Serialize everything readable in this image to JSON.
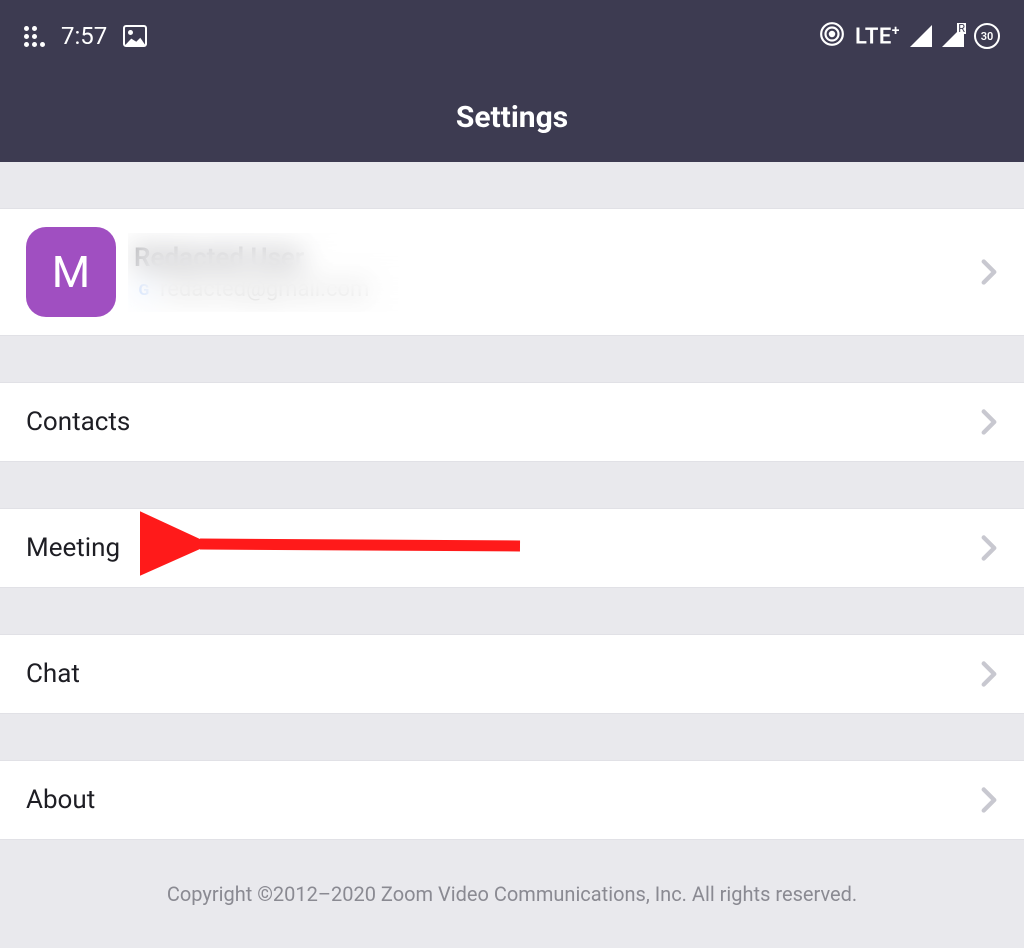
{
  "status": {
    "time": "7:57",
    "lte": "LTE",
    "lte_plus": "+",
    "roaming": "R",
    "battery": "30"
  },
  "header": {
    "title": "Settings"
  },
  "account": {
    "initial": "M",
    "name": "Redacted User",
    "email_provider": "G",
    "email": "redacted@gmail.com"
  },
  "items": [
    {
      "label": "Contacts"
    },
    {
      "label": "Meeting"
    },
    {
      "label": "Chat"
    },
    {
      "label": "About"
    }
  ],
  "footer": {
    "copyright": "Copyright ©2012–2020 Zoom Video Communications, Inc. All rights reserved."
  }
}
